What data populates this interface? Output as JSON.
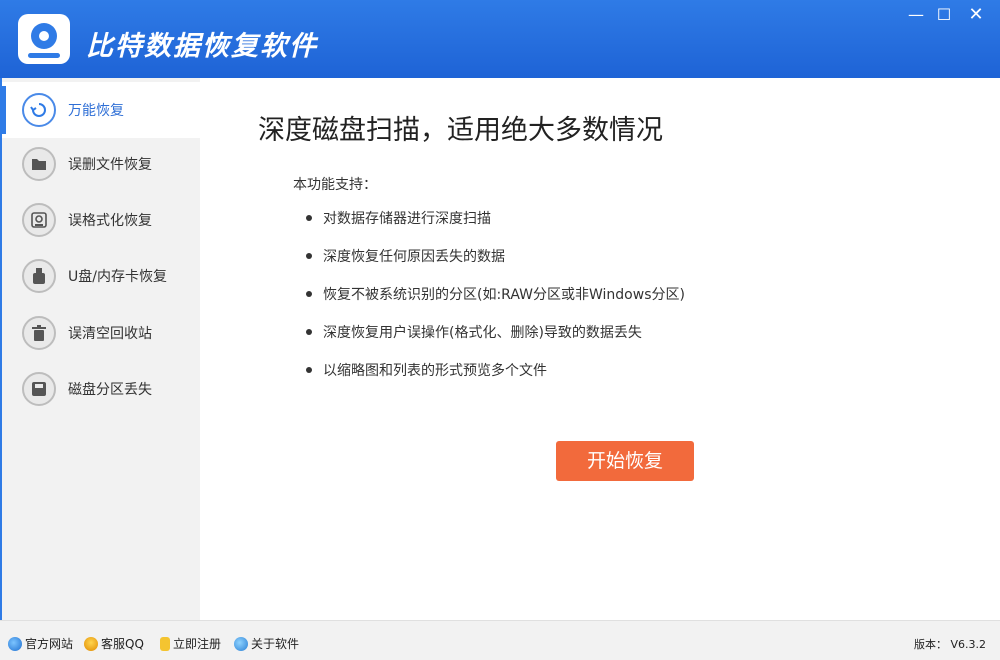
{
  "app": {
    "title": "比特数据恢复软件",
    "window_controls": {
      "minimize": "—",
      "maximize": "☐",
      "close": "✕"
    }
  },
  "sidebar": {
    "items": [
      {
        "label": "万能恢复",
        "icon": "refresh-icon",
        "active": true
      },
      {
        "label": "误删文件恢复",
        "icon": "folder-icon",
        "active": false
      },
      {
        "label": "误格式化恢复",
        "icon": "format-disk-icon",
        "active": false
      },
      {
        "label": "U盘/内存卡恢复",
        "icon": "usb-icon",
        "active": false
      },
      {
        "label": "误清空回收站",
        "icon": "trash-icon",
        "active": false
      },
      {
        "label": "磁盘分区丢失",
        "icon": "partition-icon",
        "active": false
      }
    ]
  },
  "main": {
    "headline": "深度磁盘扫描，适用绝大多数情况",
    "support_title": "本功能支持：",
    "features": [
      "对数据存储器进行深度扫描",
      "深度恢复任何原因丢失的数据",
      "恢复不被系统识别的分区(如:RAW分区或非Windows分区)",
      "深度恢复用户误操作(格式化、删除)导致的数据丢失",
      "以缩略图和列表的形式预览多个文件"
    ],
    "start_button": "开始恢复"
  },
  "footer": {
    "links": [
      {
        "label": "官方网站",
        "icon": "ie-icon"
      },
      {
        "label": "客服QQ",
        "icon": "qq-icon"
      },
      {
        "label": "立即注册",
        "icon": "key-icon"
      },
      {
        "label": "关于软件",
        "icon": "info-icon"
      }
    ],
    "version": "版本： V6.3.2"
  },
  "colors": {
    "titlebar": "#1e63d6",
    "accent": "#2f7be6",
    "start_button": "#f26a3c",
    "sidebar_bg": "#f2f2f2"
  }
}
